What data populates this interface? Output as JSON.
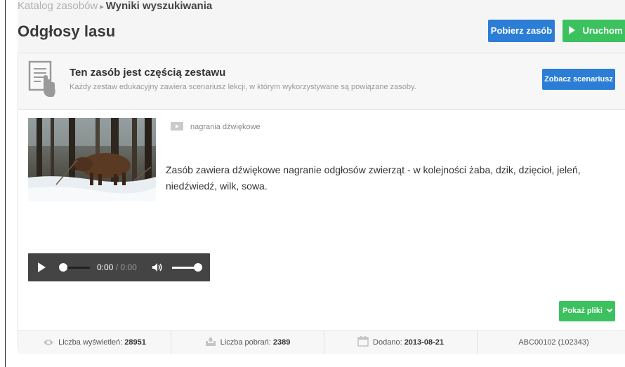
{
  "breadcrumb": {
    "items": [
      {
        "label": "Katalog zasobów"
      },
      {
        "label": "Wyniki wyszukiwania"
      }
    ],
    "separator": "▸"
  },
  "page": {
    "title": "Odgłosy lasu"
  },
  "toolbar": {
    "download_label": "Pobierz zasób",
    "run_label": "Uruchom"
  },
  "set_info": {
    "title": "Ten zasób jest częścią zestawu",
    "description": "Każdy zestaw edukacyjny zawiera scenariusz lekcji, w którym wykorzystywane są powiązane zasoby.",
    "scenario_button": "Zobacz scenariusz"
  },
  "resource": {
    "type_label": "nagrania dźwiękowe",
    "description": "Zasób zawiera dźwiękowe nagranie odgłosów zwierząt - w kolejności żaba, dzik, dzięcioł, jeleń, niedźwiedź, wilk, sowa."
  },
  "audio_player": {
    "current_time": "0:00",
    "separator": "/",
    "duration": "0:00",
    "progress": 0,
    "volume": 1
  },
  "show_files_label": "Pokaż pliki",
  "stats": {
    "views_label": "Liczba wyświetleń:",
    "views_value": "28951",
    "downloads_label": "Liczba pobrań:",
    "downloads_value": "2389",
    "added_label": "Dodano:",
    "added_value": "2013-08-21",
    "id_value": "ABC00102 (102343)"
  },
  "colors": {
    "primary_blue": "#2b7dd6",
    "action_green": "#3bc25e",
    "player_bg": "#444444"
  },
  "icons": {
    "doc": "document-touch-icon",
    "type": "video-frame-icon",
    "views": "eye-icon",
    "downloads": "download-tray-icon",
    "added": "calendar-icon"
  }
}
